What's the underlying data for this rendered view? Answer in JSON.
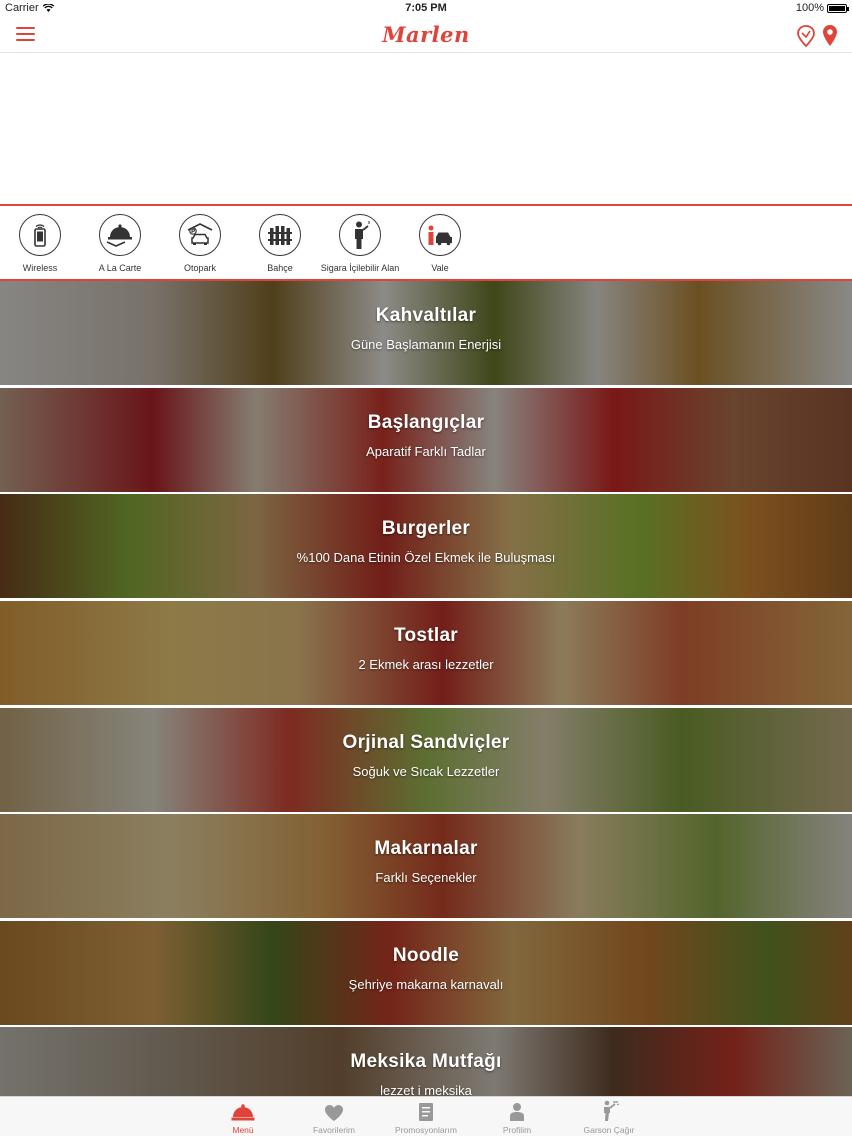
{
  "status_bar": {
    "carrier": "Carrier",
    "time": "7:05 PM",
    "battery": "100%"
  },
  "nav": {
    "logo": "Marlen",
    "icons": [
      "menu-icon",
      "route-pin-icon",
      "location-pin-icon"
    ]
  },
  "features": [
    {
      "label": "Wireless",
      "icon": "phone-wifi-icon"
    },
    {
      "label": "A La Carte",
      "icon": "cloche-icon"
    },
    {
      "label": "Otopark",
      "icon": "parking-car-icon"
    },
    {
      "label": "Bahçe",
      "icon": "garden-fence-icon"
    },
    {
      "label": "Sigara İçilebilir Alan",
      "icon": "smoking-person-icon"
    },
    {
      "label": "Vale",
      "icon": "valet-car-icon"
    }
  ],
  "categories": [
    {
      "title": "Kahvaltılar",
      "subtitle": "Güne Başlamanın Enerjisi"
    },
    {
      "title": "Başlangıçlar",
      "subtitle": "Aparatif Farklı Tadlar"
    },
    {
      "title": "Burgerler",
      "subtitle": "%100 Dana Etinin Özel Ekmek ile Buluşması"
    },
    {
      "title": "Tostlar",
      "subtitle": "2 Ekmek arası lezzetler"
    },
    {
      "title": "Orjinal Sandviçler",
      "subtitle": "Soğuk ve Sıcak Lezzetler"
    },
    {
      "title": "Makarnalar",
      "subtitle": "Farklı Seçenekler"
    },
    {
      "title": "Noodle",
      "subtitle": "Şehriye makarna karnavalı"
    },
    {
      "title": "Meksika Mutfağı",
      "subtitle": "lezzet i meksika"
    }
  ],
  "tabs": [
    {
      "label": "Menü",
      "icon": "cloche-icon",
      "active": true
    },
    {
      "label": "Favorilerim",
      "icon": "heart-icon",
      "active": false
    },
    {
      "label": "Promosyonlarım",
      "icon": "document-icon",
      "active": false
    },
    {
      "label": "Profilim",
      "icon": "person-icon",
      "active": false
    },
    {
      "label": "Garson Çağır",
      "icon": "waiter-icon",
      "active": false
    }
  ],
  "colors": {
    "accent": "#e0433a",
    "tab_inactive": "#999999"
  }
}
